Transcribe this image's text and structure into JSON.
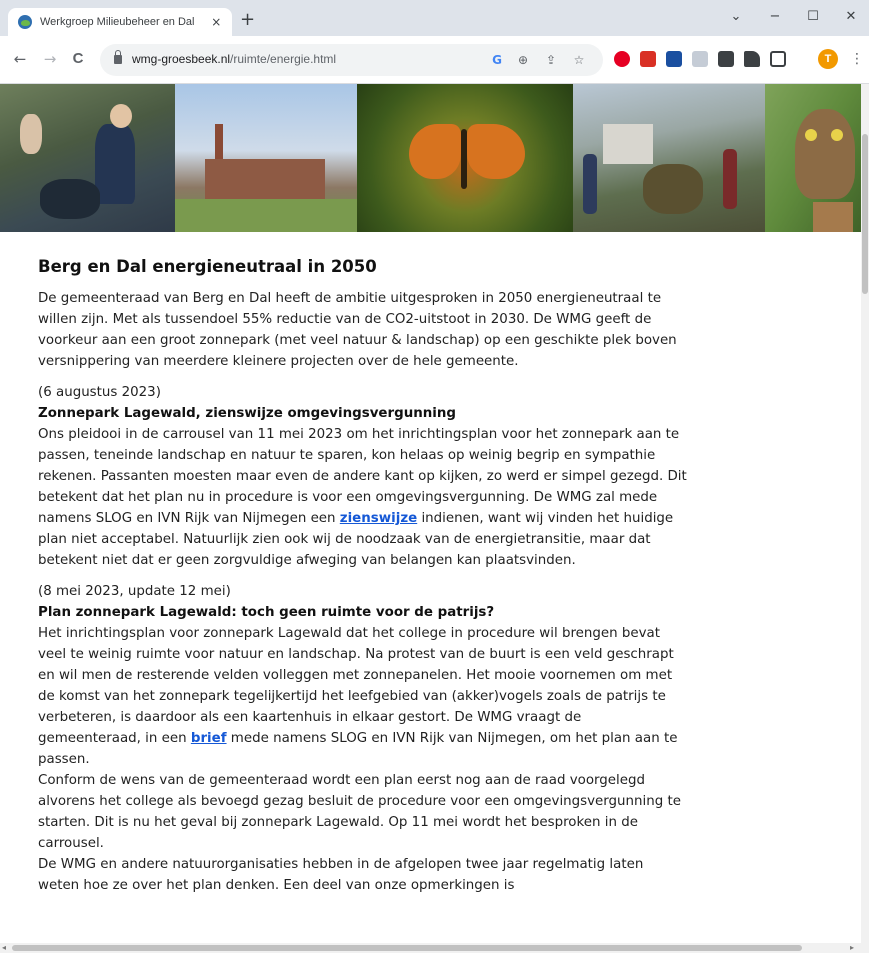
{
  "browser": {
    "tab_title": "Werkgroep Milieubeheer en Dal",
    "tab_close": "×",
    "new_tab": "+",
    "url_domain": "wmg-groesbeek.nl",
    "url_path": "/ruimte/energie.html",
    "nav": {
      "back": "←",
      "forward": "→",
      "reload": "C"
    },
    "window": {
      "minimize": "−",
      "maximize": "☐",
      "close": "✕",
      "dropdown": "⌄"
    },
    "omnibox_icons": [
      "google-lens-icon",
      "zoom-icon",
      "share-icon",
      "bookmark-star-icon"
    ],
    "omnibox_glyphs": {
      "lens": "G",
      "zoom": "⊕",
      "share": "⇪",
      "star": "☆"
    },
    "extensions": [
      {
        "name": "pinterest-ext-icon",
        "color": "#e60023"
      },
      {
        "name": "red-ext-icon",
        "color": "#d93025"
      },
      {
        "name": "blue-grid-ext-icon",
        "color": "#1a4fa0"
      },
      {
        "name": "doc-ext-icon",
        "color": "#c5ccd6"
      },
      {
        "name": "calculator-ext-icon",
        "color": "#3c4043"
      },
      {
        "name": "puzzle-icon",
        "color": "#3c4043"
      },
      {
        "name": "side-panel-icon",
        "color": "#3c4043"
      }
    ],
    "profile_initial": "T",
    "menu": "⋮",
    "accent_color": "#1558d6"
  },
  "article": {
    "heading": "Berg en Dal energieneutraal in 2050",
    "intro": "De gemeenteraad van Berg en Dal heeft de ambitie uitgesproken in 2050 energieneutraal te willen zijn. Met als tussendoel 55% reductie van de CO2-uitstoot in 2030. De WMG geeft de voorkeur aan een groot zonnepark (met veel natuur & landschap) op een geschikte plek boven versnippering van meerdere kleinere projecten over de hele gemeente.",
    "item1": {
      "date": "(6 augustus 2023)",
      "title": "Zonnepark Lagewald, zienswijze omgevingsvergunning",
      "text_a": "Ons pleidooi in de carrousel van 11 mei 2023 om het inrichtingsplan voor het zonnepark aan te passen, teneinde landschap en natuur te sparen, kon helaas op weinig begrip en sympathie rekenen. Passanten moesten maar even de andere kant op kijken, zo werd er simpel gezegd. Dit betekent dat het plan nu in procedure is voor een omgevingsvergunning. De WMG zal mede namens SLOG en IVN Rijk van Nijmegen een ",
      "link": "zienswijze",
      "text_b": " indienen, want wij vinden het huidige plan niet acceptabel. Natuurlijk zien ook wij de noodzaak van de energietransitie, maar dat betekent niet dat er geen zorgvuldige afweging van belangen kan plaatsvinden."
    },
    "item2": {
      "date": "(8 mei 2023, update 12 mei)",
      "title": "Plan zonnepark Lagewald: toch geen ruimte voor de patrijs?",
      "text_a": "Het inrichtingsplan voor zonnepark Lagewald dat het college in procedure wil brengen bevat veel te weinig ruimte voor natuur en landschap. Na protest van de buurt is een veld geschrapt en wil men de resterende velden volleggen met zonnepanelen. Het mooie voornemen om met de komst van het zonnepark tegelijkertijd het leefgebied van (akker)vogels zoals de patrijs te verbeteren, is daardoor als een kaartenhuis in elkaar gestort. De WMG vraagt de gemeenteraad, in een ",
      "link": "brief",
      "text_b": " mede namens SLOG en IVN Rijk van Nijmegen, om het plan aan te passen.",
      "para2": "Conform de wens van de gemeenteraad wordt een plan eerst nog aan de raad voorgelegd alvorens het college als bevoegd gezag besluit de procedure voor een omgevingsvergunning te starten. Dit is nu het geval bij zonnepark Lagewald. Op 11 mei wordt het besproken in de carrousel.",
      "para3": "De WMG en andere natuurorganisaties hebben in de afgelopen twee jaar regelmatig laten weten hoe ze over het plan denken. Een deel van onze opmerkingen is"
    }
  }
}
